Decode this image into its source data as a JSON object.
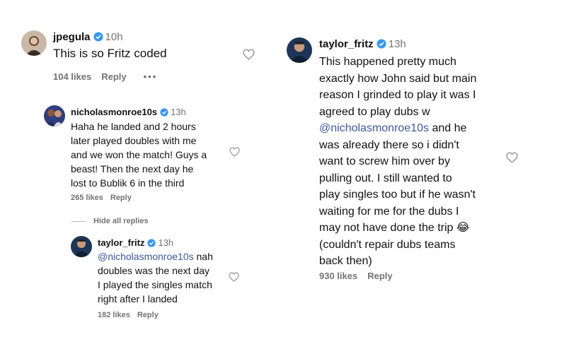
{
  "left": {
    "top_comment": {
      "username": "jpegula",
      "time": "10h",
      "text": "This is so Fritz coded",
      "likes": "104 likes",
      "reply": "Reply",
      "more": "•••"
    },
    "reply1": {
      "username": "nicholasmonroe10s",
      "time": "13h",
      "lines": [
        "Haha he landed and 2 hours",
        "later played doubles with me",
        "and we won the match! Guys a",
        "beast! Then the next day he",
        "lost to Bublik 6 in the third"
      ],
      "likes": "265 likes",
      "reply": "Reply"
    },
    "hide_replies": "Hide all replies",
    "reply2": {
      "username": "taylor_fritz",
      "time": "13h",
      "mention": "@nicholasmonroe10s",
      "line1_rest": " nah",
      "lines": [
        "doubles was the next day",
        "I played the singles match",
        "right after I landed"
      ],
      "likes": "182 likes",
      "reply": "Reply"
    }
  },
  "right": {
    "comment": {
      "username": "taylor_fritz",
      "time": "13h",
      "lines_before": [
        "This happened pretty much",
        "exactly how John said but main",
        "reason I grinded to play it was I",
        "agreed to play dubs w"
      ],
      "mention": "@nicholasmonroe10s",
      "mention_rest": " and he",
      "lines_after": [
        "was already there so i didn't",
        "want to screw him over by",
        "pulling out. I still wanted to",
        "play singles too but if he wasn't",
        "waiting for me for the dubs I",
        "may not have done the trip 😂",
        "(couldn't repair dubs teams",
        "back then)"
      ],
      "likes": "930 likes",
      "reply": "Reply"
    }
  },
  "colors": {
    "verified": "#3897f0",
    "mention": "#3d5a99",
    "muted": "#737373"
  }
}
